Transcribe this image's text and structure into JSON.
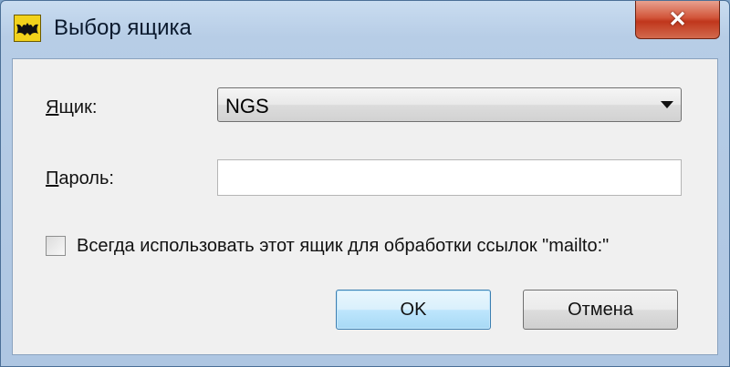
{
  "window": {
    "title": "Выбор ящика",
    "close_label": "✕",
    "icon": "bat-icon"
  },
  "form": {
    "mailbox_label": "Ящик:",
    "mailbox_accel": "Я",
    "mailbox_rest": "щик:",
    "mailbox_value": "NGS",
    "password_label": "Пароль:",
    "password_accel": "П",
    "password_rest": "ароль:",
    "password_value": "",
    "checkbox_label": "Всегда использовать этот ящик для обработки ссылок \"mailto:\"",
    "checkbox_checked": false
  },
  "buttons": {
    "ok_label": "OK",
    "cancel_label": "Отмена"
  },
  "colors": {
    "title_bar": "#b7cde6",
    "close_button": "#c0361c",
    "default_button_border": "#3c7fb1"
  }
}
